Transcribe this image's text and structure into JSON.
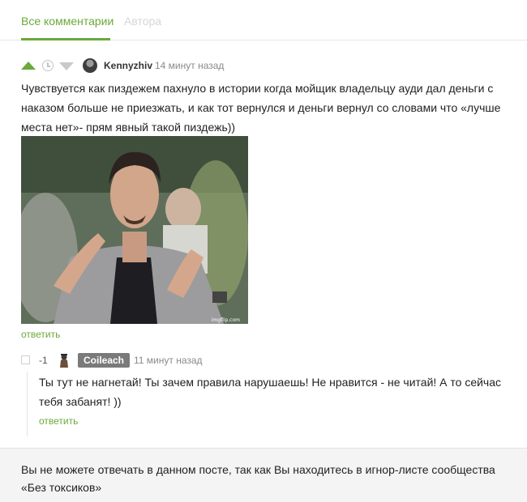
{
  "tabs": {
    "all_comments": "Все комментарии",
    "author": "Автора"
  },
  "colors": {
    "accent_green": "#6ba93a",
    "muted_gray": "#8a8a8a",
    "badge_gray": "#7a7a7a"
  },
  "comment": {
    "author": "Kennyzhiv",
    "time": "14 минут назад",
    "text": "Чувствуется как пиздежем пахнуло в истории когда мойщик владельцу ауди дал деньги с наказом больше не приезжать, и как тот вернулся и деньги вернул со словами что «лучше места нет»- прям явный такой пиздежь))",
    "image_watermark": "imgflip.com",
    "reply_label": "ответить",
    "icons": [
      "upvote-arrow-icon",
      "clock-icon",
      "downvote-arrow-icon",
      "avatar"
    ]
  },
  "reply": {
    "rating": "-1",
    "author": "Coileach",
    "time": "11 минут назад",
    "text": "Ты тут не нагнетай! Ты зачем правила нарушаешь! Не нравится - не читай! А то сейчас тебя забанят! ))",
    "reply_label": "ответить"
  },
  "notice": {
    "text": "Вы не можете отвечать в данном посте, так как Вы находитесь в игнор-листе сообщества «Без токсиков»"
  }
}
